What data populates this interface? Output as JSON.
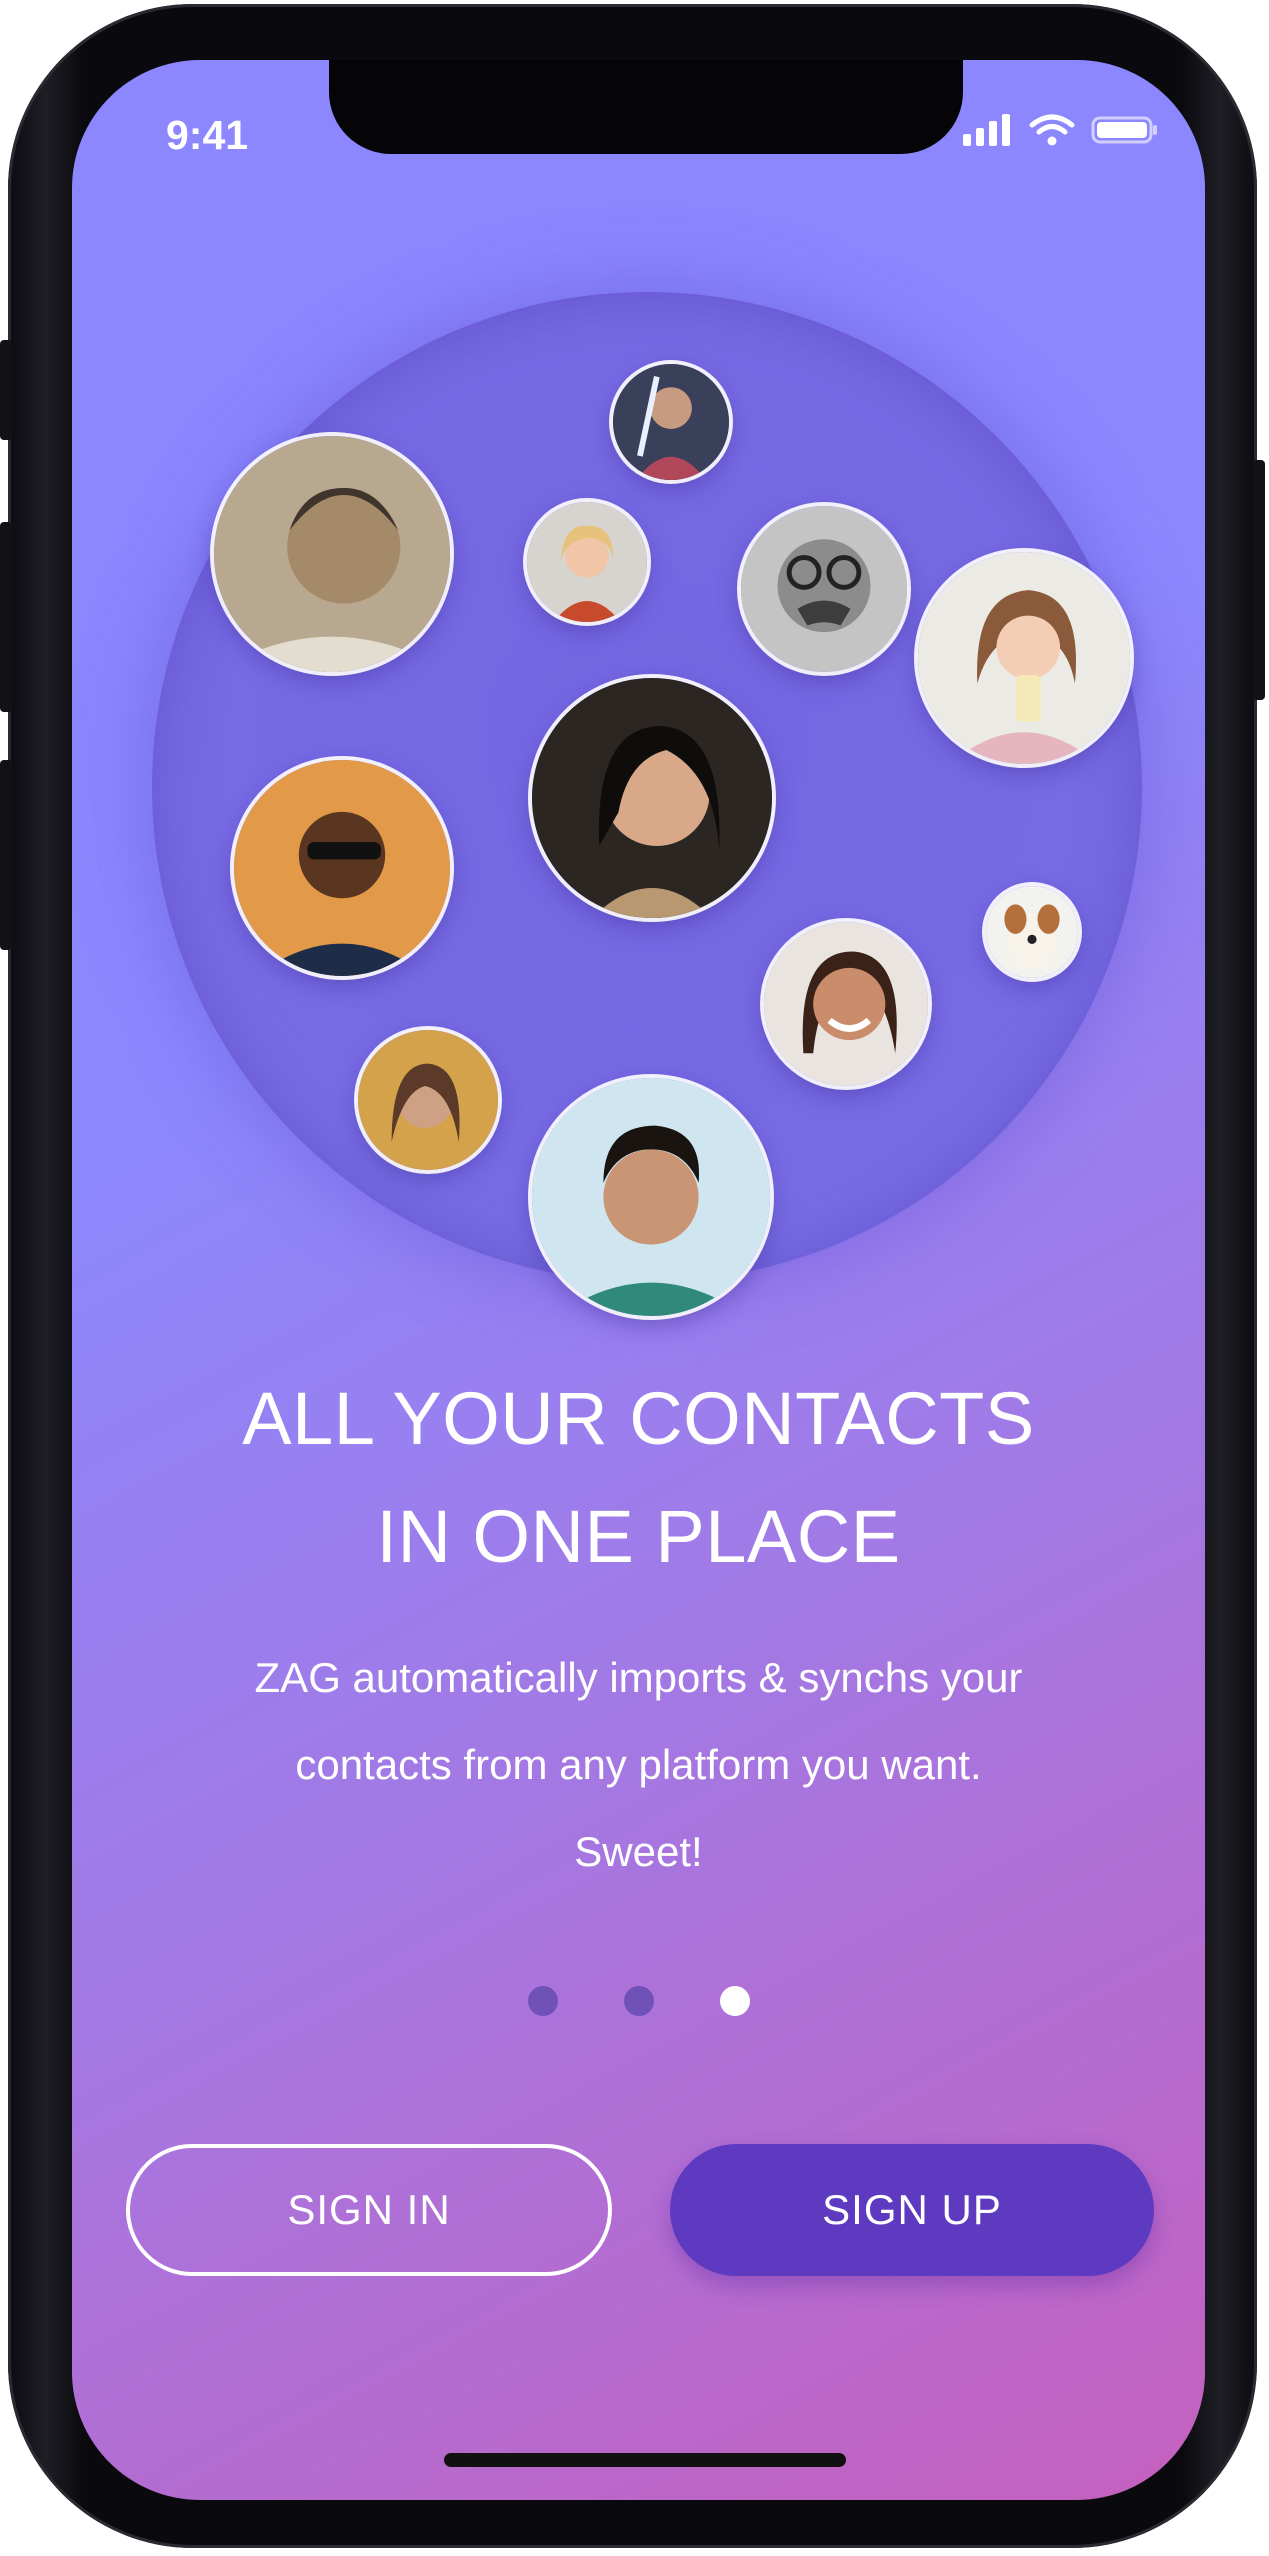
{
  "status_bar": {
    "time": "9:41"
  },
  "onboarding": {
    "headline_line1": "ALL YOUR CONTACTS",
    "headline_line2": "IN ONE PLACE",
    "body_line1": "ZAG automatically imports & synchs your",
    "body_line2": "contacts from any platform you want.",
    "body_line3": "Sweet!",
    "page_indicator": {
      "total": 3,
      "current": 3
    }
  },
  "actions": {
    "sign_in_label": "SIGN IN",
    "sign_up_label": "SIGN UP"
  },
  "colors": {
    "gradient_start": "#8c86ff",
    "gradient_end": "#c560be",
    "sign_up_button": "#5e3ac0",
    "dot_inactive": "#7051b8",
    "dot_active": "#ffffff"
  }
}
